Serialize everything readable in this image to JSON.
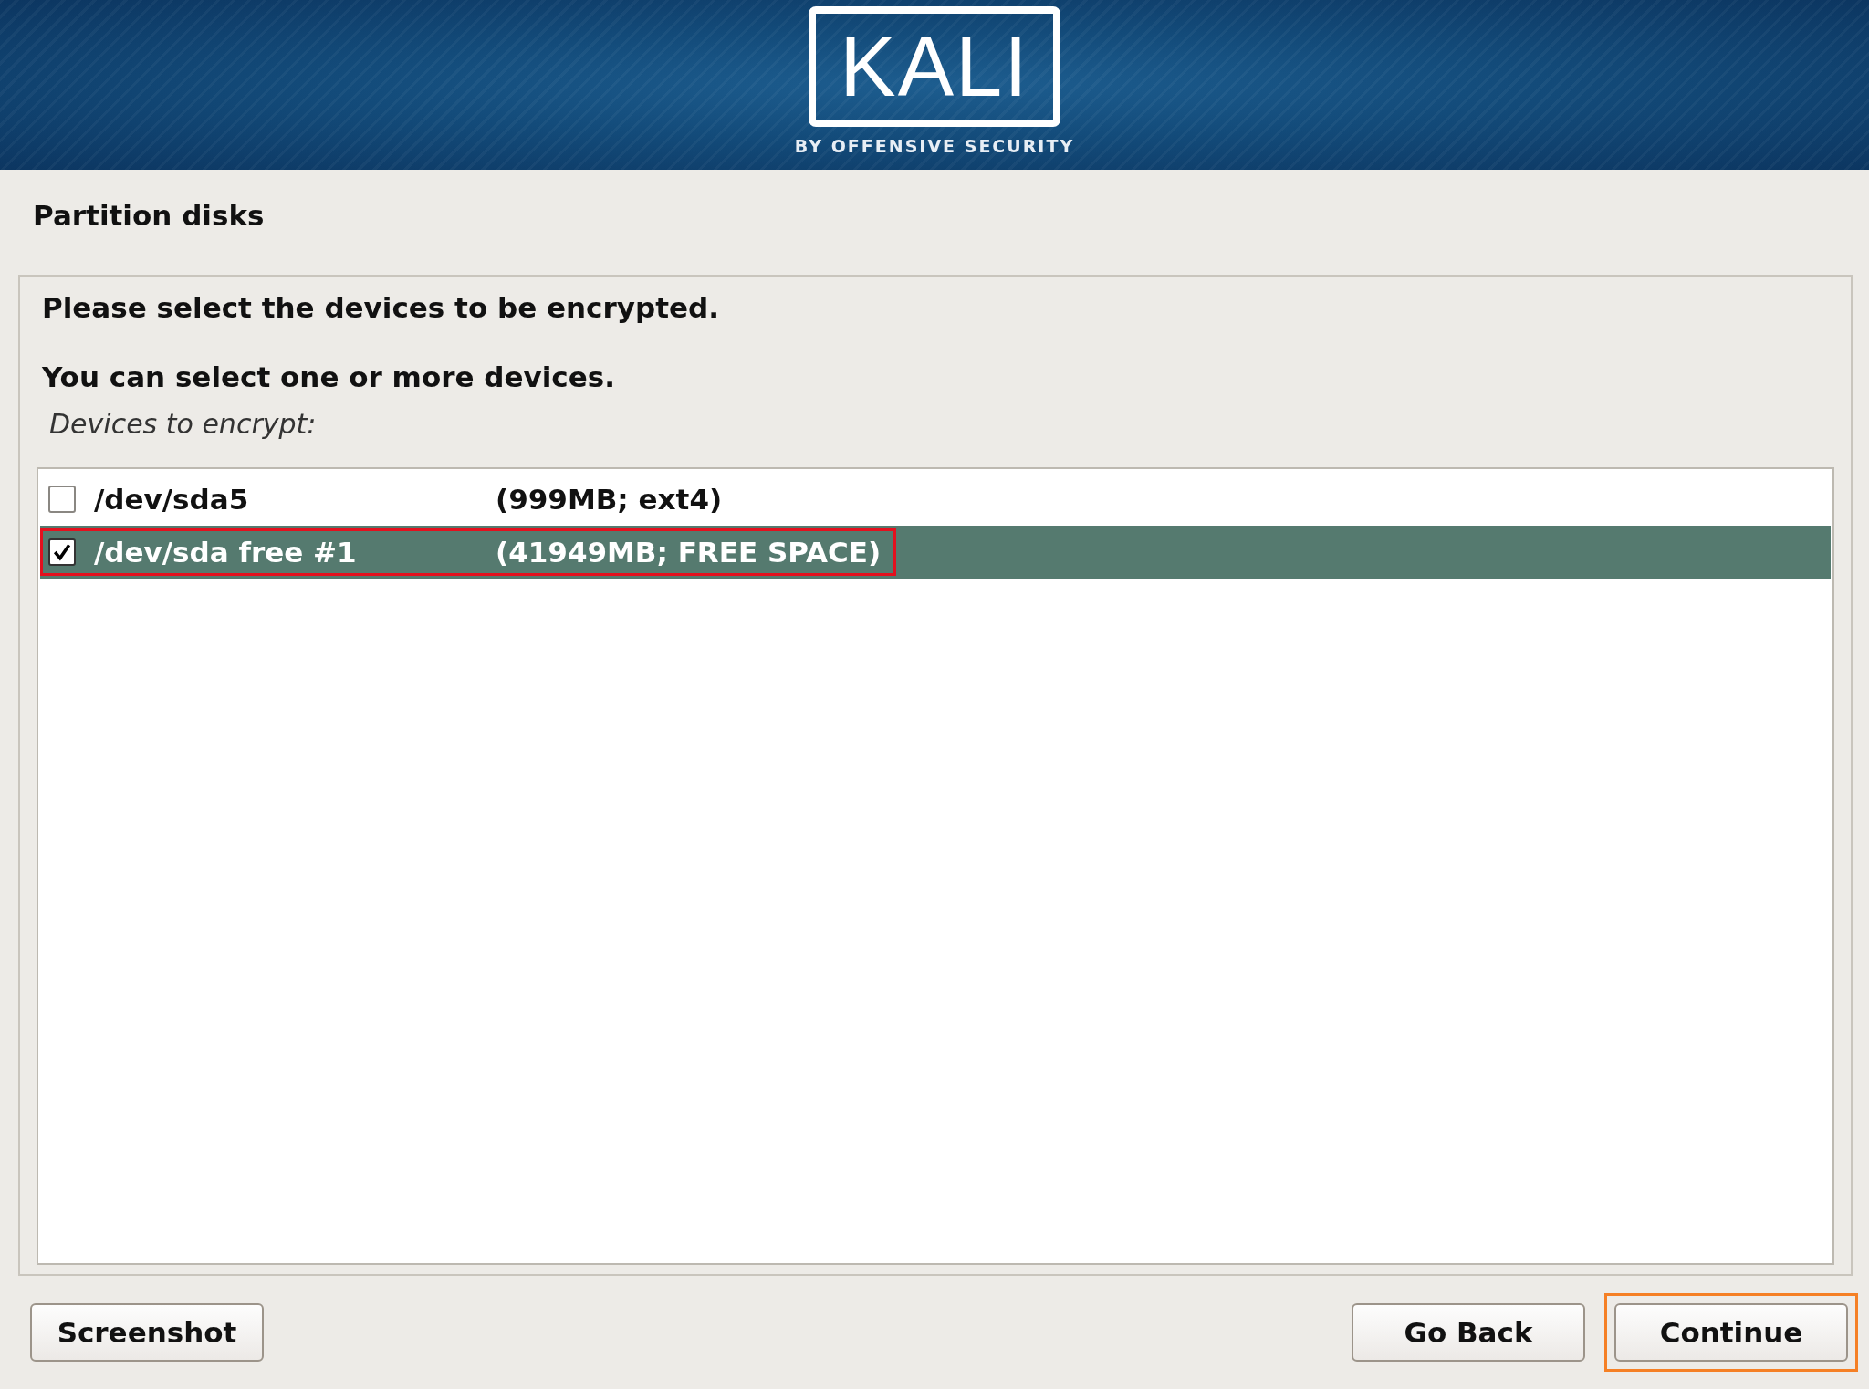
{
  "logo": {
    "name": "KALI",
    "tagline": "BY OFFENSIVE SECURITY"
  },
  "page_title": "Partition disks",
  "prompt": "Please select the devices to be encrypted.",
  "hint": "You can select one or more devices.",
  "list_label": "Devices to encrypt:",
  "devices": [
    {
      "name": "/dev/sda5",
      "size": "(999MB; ext4)",
      "checked": false,
      "selected": false,
      "highlighted": false
    },
    {
      "name": "/dev/sda free #1",
      "size": "(41949MB; FREE SPACE)",
      "checked": true,
      "selected": true,
      "highlighted": true
    }
  ],
  "buttons": [
    {
      "label": "Screenshot",
      "kind": "left",
      "highlighted": false
    },
    {
      "label": "Go Back",
      "kind": "right",
      "highlighted": false
    },
    {
      "label": "Continue",
      "kind": "right",
      "highlighted": true
    }
  ]
}
